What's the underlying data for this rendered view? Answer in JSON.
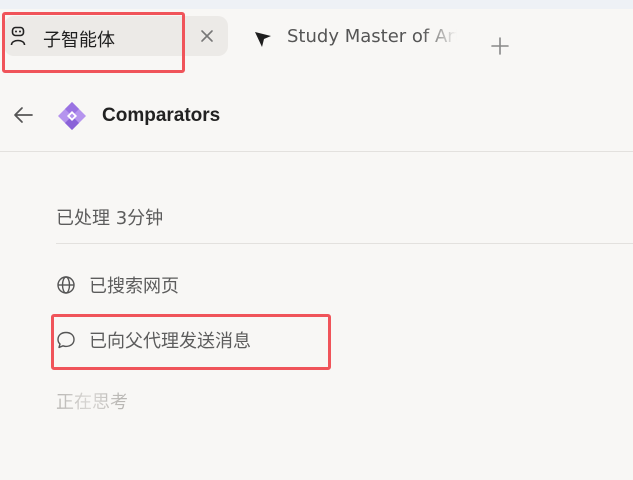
{
  "tabs": {
    "active": {
      "label": "子智能体",
      "icon": "robot-icon"
    },
    "second": {
      "label": "Study Master of Art",
      "icon": "arrow-cursor-icon"
    }
  },
  "header": {
    "title": "Comparators",
    "logo": "purple-diamond-logo"
  },
  "activity": {
    "processed": "已处理 3分钟",
    "steps": [
      {
        "icon": "globe-icon",
        "label": "已搜索网页"
      },
      {
        "icon": "speech-bubble-icon",
        "label": "已向父代理发送消息"
      }
    ],
    "thinking": "正在思考"
  },
  "colors": {
    "highlight": "#f0545a",
    "logo_purple": "#a27ee6",
    "background": "#f8f7f5"
  }
}
